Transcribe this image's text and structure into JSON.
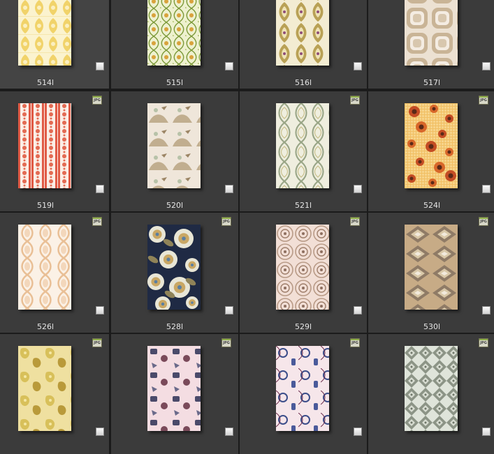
{
  "items": [
    {
      "label": "514l",
      "badge": "",
      "pattern": "damask-yellow"
    },
    {
      "label": "515l",
      "badge": "",
      "pattern": "ogee-green"
    },
    {
      "label": "516l",
      "badge": "",
      "pattern": "damask-olive"
    },
    {
      "label": "517l",
      "badge": "",
      "pattern": "retro-squares-beige"
    },
    {
      "label": "519l",
      "badge": "JPG",
      "pattern": "stripes-red"
    },
    {
      "label": "520l",
      "badge": "",
      "pattern": "toile-beige"
    },
    {
      "label": "521l",
      "badge": "JPG",
      "pattern": "trellis-sage"
    },
    {
      "label": "524l",
      "badge": "JPG",
      "pattern": "flowers-orange"
    },
    {
      "label": "526l",
      "badge": "JPG",
      "pattern": "ogee-peach"
    },
    {
      "label": "528l",
      "badge": "JPG",
      "pattern": "floral-navy"
    },
    {
      "label": "529l",
      "badge": "JPG",
      "pattern": "medallion-pink"
    },
    {
      "label": "530l",
      "badge": "JPG",
      "pattern": "diamond-taupe"
    },
    {
      "label": "",
      "badge": "JPG",
      "pattern": "floral-mustard"
    },
    {
      "label": "",
      "badge": "JPG",
      "pattern": "chinoiserie-pink"
    },
    {
      "label": "",
      "badge": "JPG",
      "pattern": "chinoiserie-blue"
    },
    {
      "label": "",
      "badge": "JPG",
      "pattern": "lattice-grey"
    }
  ]
}
